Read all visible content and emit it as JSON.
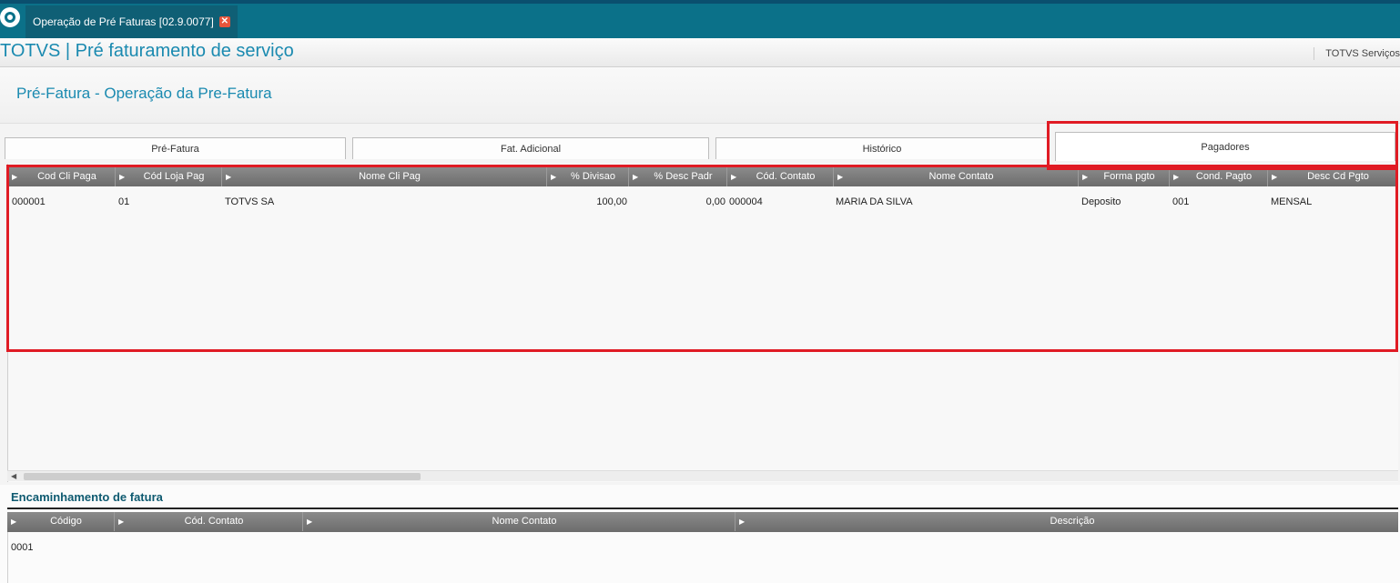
{
  "app_tab": {
    "label": "Operação de Pré Faturas [02.9.0077]"
  },
  "header": {
    "title": "TOTVS | Pré faturamento de serviço",
    "company": "TOTVS Serviços"
  },
  "subtitle": "Pré-Fatura - Operação da Pre-Fatura",
  "tabs": [
    {
      "label": "Pré-Fatura"
    },
    {
      "label": "Fat. Adicional"
    },
    {
      "label": "Histórico"
    },
    {
      "label": "Pagadores",
      "active": true
    }
  ],
  "pagadores_grid": {
    "columns": [
      "Cod Cli Paga",
      "Cód Loja Pag",
      "Nome Cli Pag",
      "% Divisao",
      "% Desc Padr",
      "Cód. Contato",
      "Nome Contato",
      "Forma pgto",
      "Cond. Pagto",
      "Desc Cd Pgto"
    ],
    "rows": [
      {
        "cod_cli": "000001",
        "cod_loja": "01",
        "nome_cli": "TOTVS SA",
        "divisao": "100,00",
        "desc_padr": "0,00",
        "cod_contato": "000004",
        "nome_contato": "MARIA DA SILVA",
        "forma_pgto": "Deposito",
        "cond_pagto": "001",
        "desc_cd_pgto": "MENSAL"
      }
    ]
  },
  "encaminhamento": {
    "title": "Encaminhamento de fatura",
    "columns": [
      "Código",
      "Cód. Contato",
      "Nome Contato",
      "Descrição"
    ],
    "rows": [
      {
        "codigo": "0001"
      }
    ]
  },
  "colors": {
    "topbar": "#0b7189",
    "accent": "#1a8ab0",
    "highlight": "#e01b24"
  }
}
